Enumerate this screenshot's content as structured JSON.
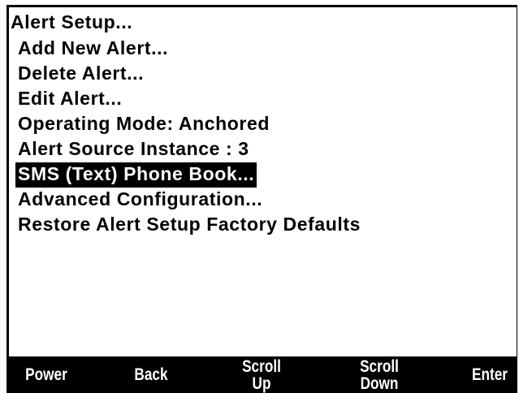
{
  "menu": {
    "title": "Alert Setup...",
    "items": [
      {
        "label": "Add New Alert...",
        "selected": false
      },
      {
        "label": "Delete Alert...",
        "selected": false
      },
      {
        "label": "Edit Alert...",
        "selected": false
      },
      {
        "label": "Operating Mode:  Anchored",
        "selected": false
      },
      {
        "label": "Alert Source Instance : 3",
        "selected": false
      },
      {
        "label": "SMS (Text) Phone Book...",
        "selected": true
      },
      {
        "label": "Advanced Configuration...",
        "selected": false
      },
      {
        "label": "Restore Alert Setup Factory Defaults",
        "selected": false
      }
    ]
  },
  "softkeys": {
    "power": "Power",
    "back": "Back",
    "scroll_up": "Scroll\nUp",
    "scroll_down": "Scroll\nDown",
    "enter": "Enter"
  },
  "colors": {
    "background": "#ffffff",
    "text": "#000000",
    "highlight_bg": "#000000",
    "highlight_text": "#ffffff"
  }
}
